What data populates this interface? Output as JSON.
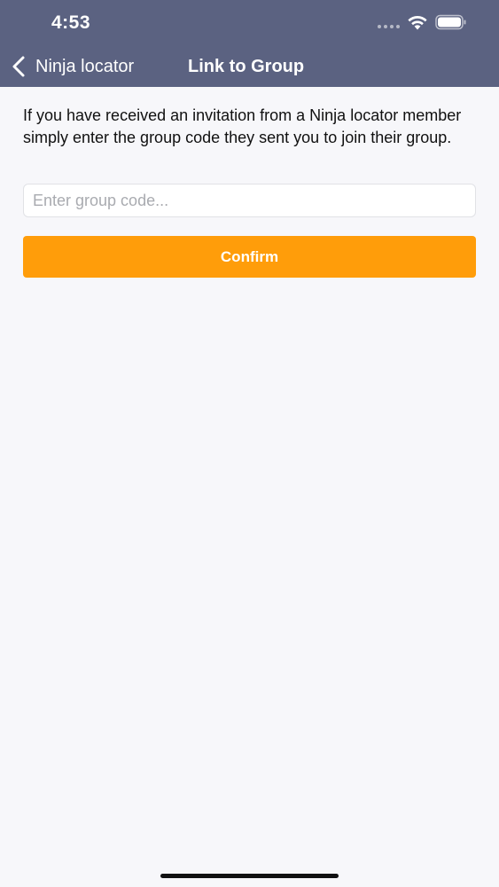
{
  "status_bar": {
    "time": "4:53",
    "icons": [
      "signal-icon",
      "wifi-icon",
      "battery-icon"
    ]
  },
  "nav": {
    "back_label": "Ninja locator",
    "title": "Link to Group",
    "back_icon": "chevron-left-icon"
  },
  "content": {
    "instructions": "If you have received an invitation from a Ninja locator member simply enter the group code they sent you to join their group.",
    "input": {
      "placeholder": "Enter group code...",
      "value": ""
    },
    "confirm_label": "Confirm"
  },
  "colors": {
    "header_bg": "#5b6281",
    "accent": "#ff9d0a",
    "page_bg": "#f7f7fa"
  }
}
